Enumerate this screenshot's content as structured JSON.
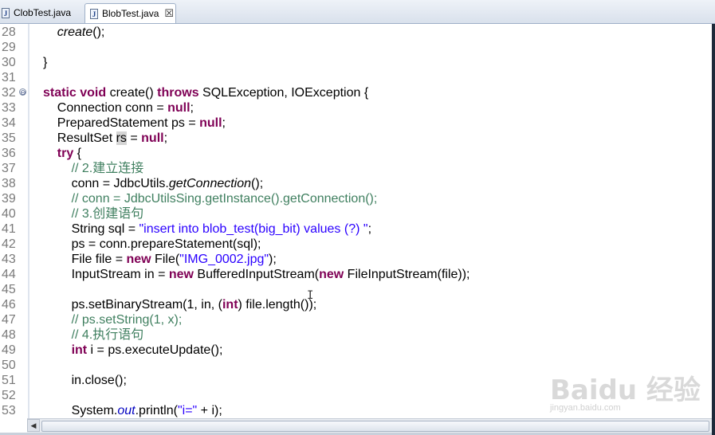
{
  "tabs": [
    {
      "label": "ClobTest.java",
      "active": false
    },
    {
      "label": "BlobTest.java",
      "active": true
    }
  ],
  "tab_close_glyph": "☒",
  "file_icon_letter": "J",
  "editor": {
    "lines": [
      {
        "n": "28",
        "seg": [
          {
            "t": "    "
          },
          {
            "t": "create",
            "c": "it"
          },
          {
            "t": "();"
          }
        ]
      },
      {
        "n": "29",
        "seg": []
      },
      {
        "n": "30",
        "seg": [
          {
            "t": "}"
          }
        ]
      },
      {
        "n": "31",
        "seg": []
      },
      {
        "n": "32",
        "fold": true,
        "seg": [
          {
            "t": "static",
            "c": "kw"
          },
          {
            "t": " "
          },
          {
            "t": "void",
            "c": "kw"
          },
          {
            "t": " create() "
          },
          {
            "t": "throws",
            "c": "kw"
          },
          {
            "t": " SQLException, IOException {"
          }
        ]
      },
      {
        "n": "33",
        "seg": [
          {
            "t": "    Connection conn = "
          },
          {
            "t": "null",
            "c": "kw"
          },
          {
            "t": ";"
          }
        ]
      },
      {
        "n": "34",
        "seg": [
          {
            "t": "    PreparedStatement ps = "
          },
          {
            "t": "null",
            "c": "kw"
          },
          {
            "t": ";"
          }
        ]
      },
      {
        "n": "35",
        "seg": [
          {
            "t": "    ResultSet "
          },
          {
            "t": "rs",
            "c": "hl"
          },
          {
            "t": " = "
          },
          {
            "t": "null",
            "c": "kw"
          },
          {
            "t": ";"
          }
        ]
      },
      {
        "n": "36",
        "seg": [
          {
            "t": "    "
          },
          {
            "t": "try",
            "c": "kw"
          },
          {
            "t": " {"
          }
        ]
      },
      {
        "n": "37",
        "seg": [
          {
            "t": "        "
          },
          {
            "t": "// 2.建立连接",
            "c": "cm"
          }
        ]
      },
      {
        "n": "38",
        "seg": [
          {
            "t": "        conn = JdbcUtils."
          },
          {
            "t": "getConnection",
            "c": "it"
          },
          {
            "t": "();"
          }
        ]
      },
      {
        "n": "39",
        "seg": [
          {
            "t": "        "
          },
          {
            "t": "// conn = JdbcUtilsSing.getInstance().getConnection();",
            "c": "cm"
          }
        ]
      },
      {
        "n": "40",
        "seg": [
          {
            "t": "        "
          },
          {
            "t": "// 3.创建语句",
            "c": "cm"
          }
        ]
      },
      {
        "n": "41",
        "seg": [
          {
            "t": "        String sql = "
          },
          {
            "t": "\"insert into blob_test(big_bit) values (?) \"",
            "c": "str"
          },
          {
            "t": ";"
          }
        ]
      },
      {
        "n": "42",
        "seg": [
          {
            "t": "        ps = conn.prepareStatement(sql);"
          }
        ]
      },
      {
        "n": "43",
        "seg": [
          {
            "t": "        File file = "
          },
          {
            "t": "new",
            "c": "kw"
          },
          {
            "t": " File("
          },
          {
            "t": "\"IMG_0002.jpg\"",
            "c": "str"
          },
          {
            "t": ");"
          }
        ]
      },
      {
        "n": "44",
        "seg": [
          {
            "t": "        InputStream in = "
          },
          {
            "t": "new",
            "c": "kw"
          },
          {
            "t": " BufferedInputStream("
          },
          {
            "t": "new",
            "c": "kw"
          },
          {
            "t": " FileInputStream(file));"
          }
        ]
      },
      {
        "n": "45",
        "seg": []
      },
      {
        "n": "46",
        "seg": [
          {
            "t": "        ps.setBinaryStream(1, in, ("
          },
          {
            "t": "int",
            "c": "kw"
          },
          {
            "t": ") file.length());"
          }
        ]
      },
      {
        "n": "47",
        "seg": [
          {
            "t": "        "
          },
          {
            "t": "// ps.setString(1, x);",
            "c": "cm"
          }
        ]
      },
      {
        "n": "48",
        "seg": [
          {
            "t": "        "
          },
          {
            "t": "// 4.执行语句",
            "c": "cm"
          }
        ]
      },
      {
        "n": "49",
        "seg": [
          {
            "t": "        "
          },
          {
            "t": "int",
            "c": "kw"
          },
          {
            "t": " i = ps.executeUpdate();"
          }
        ]
      },
      {
        "n": "50",
        "seg": []
      },
      {
        "n": "51",
        "seg": [
          {
            "t": "        in.close();"
          }
        ]
      },
      {
        "n": "52",
        "seg": []
      },
      {
        "n": "53",
        "seg": [
          {
            "t": "        System."
          },
          {
            "t": "out",
            "c": "fld"
          },
          {
            "t": ".println("
          },
          {
            "t": "\"i=\"",
            "c": "str"
          },
          {
            "t": " + i);"
          }
        ]
      }
    ]
  },
  "watermark": {
    "logo": "Baidu 经验",
    "url": "jingyan.baidu.com"
  },
  "scroll_left_glyph": "◀",
  "fold_glyph": "⊖"
}
